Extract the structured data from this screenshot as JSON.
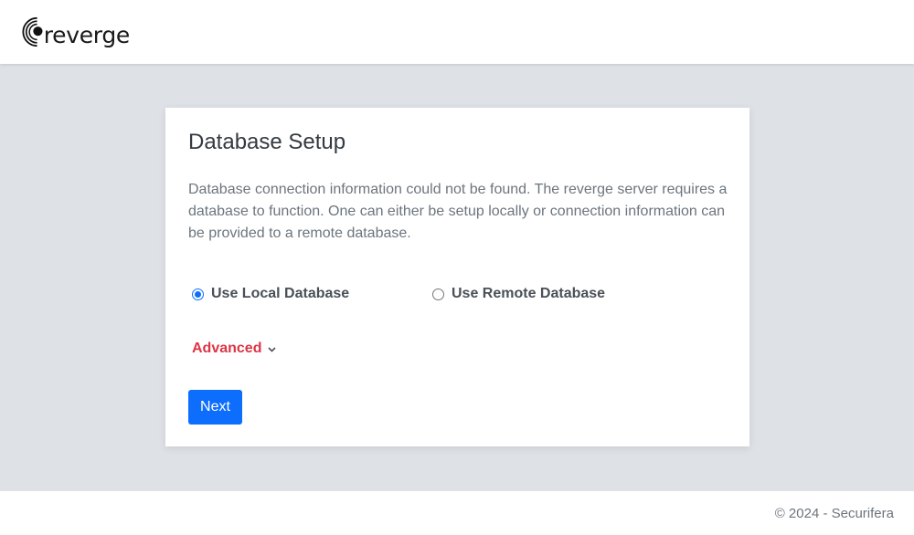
{
  "header": {
    "logo_text": "reverge"
  },
  "setup": {
    "title": "Database Setup",
    "description": "Database connection information could not be found. The reverge server requires a database to function. One can either be setup locally or connection information can be provided to a remote database.",
    "options": [
      {
        "label": "Use Local Database",
        "selected": true
      },
      {
        "label": "Use Remote Database",
        "selected": false
      }
    ],
    "advanced_label": "Advanced",
    "next_label": "Next"
  },
  "footer": {
    "copyright": "© 2024 - Securifera"
  },
  "colors": {
    "primary": "#0d6efd",
    "advanced": "#dc3545",
    "background": "#dee2e6"
  }
}
